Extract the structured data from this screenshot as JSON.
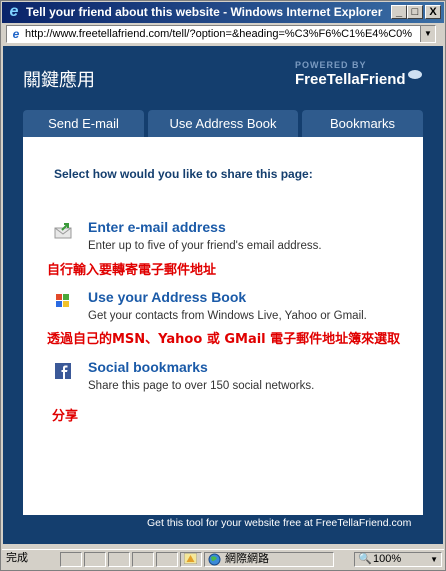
{
  "window": {
    "title": "Tell your friend about this website - Windows Internet Explorer",
    "minimize": "_",
    "maximize": "□",
    "close": "X"
  },
  "address_bar": {
    "url": "http://www.freetellafriend.com/tell/?option=&heading=%C3%F6%C1%E4%C0%",
    "dropdown": "▼"
  },
  "header": {
    "title": "關鍵應用",
    "powered_by": "POWERED BY",
    "logo": "FreeTellaFriend"
  },
  "tabs": [
    {
      "label": "Send E-mail"
    },
    {
      "label": "Use Address Book"
    },
    {
      "label": "Bookmarks"
    }
  ],
  "panel": {
    "instruction": "Select how would you like to share this page:",
    "options": [
      {
        "icon": "mail-icon",
        "title": "Enter e-mail address",
        "description": "Enter up to five of your friend's email address."
      },
      {
        "icon": "windows-icon",
        "title": "Use your Address Book",
        "description": "Get your contacts from Windows Live, Yahoo or Gmail."
      },
      {
        "icon": "facebook-icon",
        "title": "Social bookmarks",
        "description": "Share this page to over 150 social networks."
      }
    ]
  },
  "annotations": [
    "自行輸入要轉寄電子郵件地址",
    "透過自己的MSN、Yahoo 或 GMail 電子郵件地址簿來選取",
    "分享"
  ],
  "footer": {
    "text": "Get this tool for your website free at FreeTellaFriend.com"
  },
  "status_bar": {
    "status": "完成",
    "zone": "網際網路",
    "zoom": "100%"
  }
}
